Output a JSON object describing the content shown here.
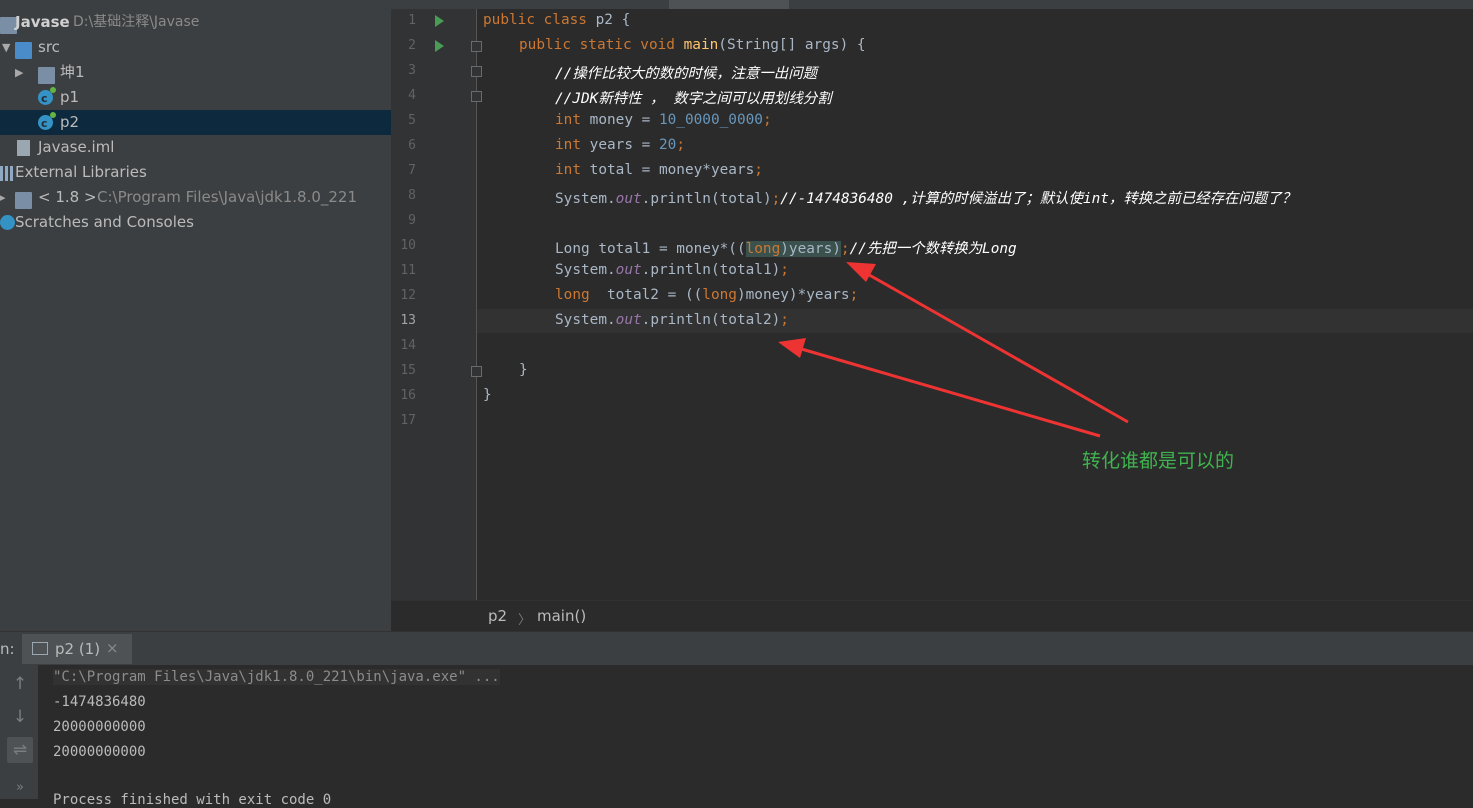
{
  "project": {
    "root_name": "Javase",
    "root_path": "D:\\基础注释\\Javase",
    "src": "src",
    "pkg": "坤1",
    "class1": "p1",
    "class2": "p2",
    "iml": "Javase.iml",
    "ext": "External Libraries",
    "jdk_name": "< 1.8 >",
    "jdk_path": "C:\\Program Files\\Java\\jdk1.8.0_221",
    "scratches": "Scratches and Consoles"
  },
  "editor": {
    "line_numbers": [
      "1",
      "2",
      "3",
      "4",
      "5",
      "6",
      "7",
      "8",
      "9",
      "10",
      "11",
      "12",
      "13",
      "14",
      "15",
      "16",
      "17"
    ],
    "l1": {
      "kw": "public class ",
      "rest": "p2 {"
    },
    "l2": {
      "kw": "public static void ",
      "fn": "main",
      "rest": "(String[] args) {"
    },
    "l3": "//操作比较大的数的时候，注意一出问题",
    "l4": "//JDK新特性 ， 数字之间可以用划线分割",
    "l5": {
      "kw": "int",
      "mid": " money = ",
      "num": "10_0000_0000",
      "end": ";"
    },
    "l6": {
      "kw": "int",
      "mid": " years = ",
      "num": "20",
      "end": ";"
    },
    "l7": {
      "kw": "int",
      "mid": " total = money*years",
      "end": ";"
    },
    "l8": {
      "a": "System.",
      "fld": "out",
      "b": ".println(total)",
      "end": ";",
      "cm": "//-1474836480 ,计算的时候溢出了；默认使int，转换之前已经存在问题了？"
    },
    "l10": {
      "a": "Long total1 = money*((",
      "kw": "long",
      "b": ")years)",
      "end": ";",
      "cm": "//先把一个数转换为Long"
    },
    "l11": {
      "a": "System.",
      "fld": "out",
      "b": ".println(total1)",
      "end": ";"
    },
    "l12": {
      "kw": "long",
      "a": "  total2 = ((",
      "kw2": "long",
      "b": ")money)*years",
      "end": ";"
    },
    "l13": {
      "a": "System.",
      "fld": "out",
      "b": ".println(total2)",
      "end": ";"
    },
    "l15": "}",
    "l16": "}"
  },
  "breadcrumb": {
    "cls": "p2",
    "sep": "〉",
    "method": "main()"
  },
  "run": {
    "label": "n:",
    "tab_label": "p2 (1)",
    "close": "×",
    "lines": [
      "\"C:\\Program Files\\Java\\jdk1.8.0_221\\bin\\java.exe\" ...",
      "-1474836480",
      "20000000000",
      "20000000000"
    ],
    "partial_line": "Process finished with exit code 0"
  },
  "annotation": "转化谁都是可以的",
  "colors": {
    "arrow": "#ee3333",
    "note": "#3fb34f"
  }
}
